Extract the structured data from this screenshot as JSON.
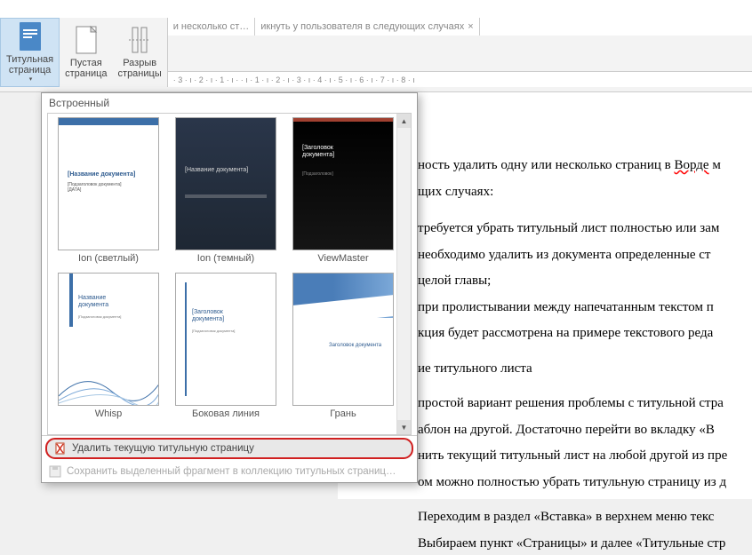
{
  "ribbon": {
    "cover_page": "Титульная\nстраница",
    "blank_page": "Пустая\nстраница",
    "page_break": "Разрыв\nстраницы"
  },
  "tabs": {
    "tab1": "и несколько ст…",
    "tab2": "икнуть у пользователя в следующих случаях"
  },
  "ruler": "· 3 · ı · 2 · ı · 1 · ı ·   · ı · 1 · ı · 2 · ı · 3 · ı · 4 · ı · 5 · ı · 6 · ı · 7 · ı · 8 · ı",
  "gallery": {
    "header": "Встроенный",
    "items": [
      {
        "label": "Ion (светлый)",
        "title": "[Название документа]",
        "sub": "[Подзаголовок документа]\n[ДАТА]"
      },
      {
        "label": "Ion (темный)",
        "title": "[Название документа]"
      },
      {
        "label": "ViewMaster",
        "title": "[Заголовок\nдокумента]",
        "sub": "[Подзаголовок]"
      },
      {
        "label": "Whisp",
        "title": "Название\nдокумента",
        "sub": "[Подзаголовок документа]"
      },
      {
        "label": "Боковая линия",
        "title": "[Заголовок\nдокумента]",
        "sub": "[Подзаголовок документа]"
      },
      {
        "label": "Грань",
        "title": "Заголовок документа"
      }
    ],
    "footer": {
      "remove": "Удалить текущую титульную страницу",
      "save": "Сохранить выделенный фрагмент в коллекцию титульных страниц…"
    }
  },
  "document": {
    "p1a": "ность удалить одну или несколько страниц в ",
    "p1b": "Ворде",
    "p1c": " м",
    "p2": "щих случаях:",
    "p3": "требуется убрать титульный лист полностью или зам",
    "p4": "необходимо удалить из документа определенные ст",
    "p5": "целой главы;",
    "p6": "при пролистывании между напечатанным текстом п",
    "p7": "кция будет рассмотрена на примере текстового реда",
    "p8": "ие титульного листа",
    "p9": "простой вариант решения проблемы с титульной стра",
    "p10": "аблон на другой. Достаточно перейти во вкладку «В",
    "p11": "нить текущий титульный лист на любой другой из пре",
    "p12": "ом можно полностью убрать титульную страницу из д",
    "p13": "Переходим в раздел «Вставка» в верхнем меню текс",
    "p14": "Выбираем пункт «Страницы» и далее «Титульные стр"
  }
}
